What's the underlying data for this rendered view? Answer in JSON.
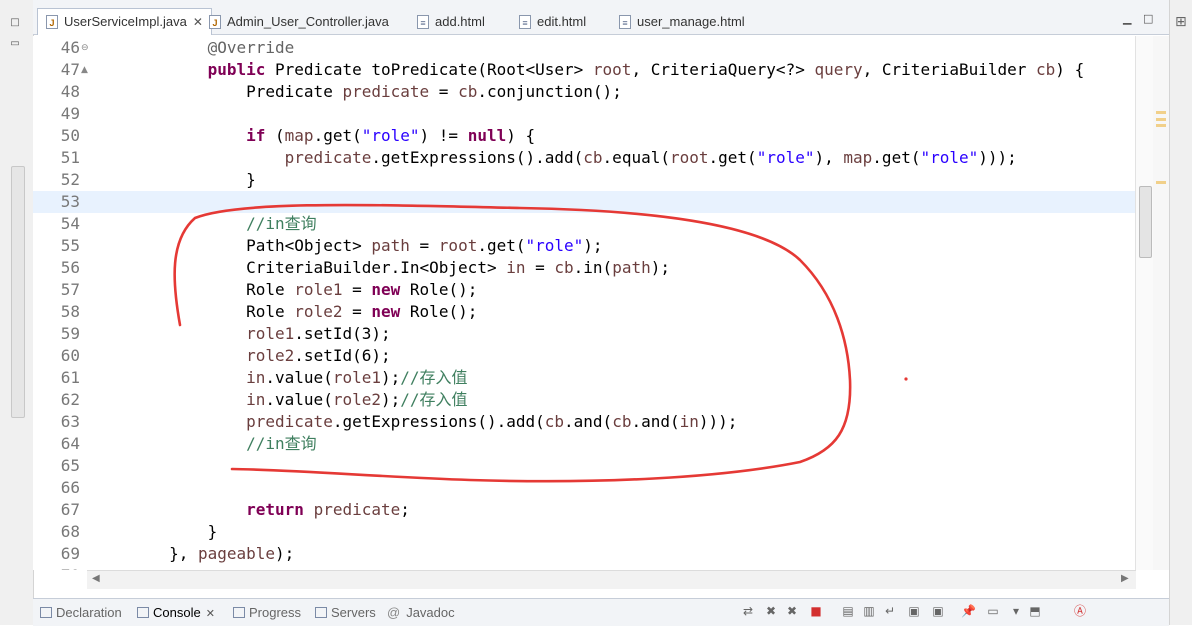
{
  "editor": {
    "tabs": [
      {
        "label": "UserServiceImpl.java",
        "icon": "java-file-icon",
        "active": true,
        "closable": true
      },
      {
        "label": "Admin_User_Controller.java",
        "icon": "java-file-icon"
      },
      {
        "label": "add.html",
        "icon": "html-file-icon"
      },
      {
        "label": "edit.html",
        "icon": "html-file-icon"
      },
      {
        "label": "user_manage.html",
        "icon": "html-file-icon"
      }
    ],
    "lines": [
      {
        "n": "46",
        "fold": "⊖",
        "segs": [
          [
            "            ",
            ""
          ],
          [
            "@Override",
            "an"
          ]
        ]
      },
      {
        "n": "47",
        "fold": "▲",
        "segs": [
          [
            "            ",
            ""
          ],
          [
            "public",
            "kw"
          ],
          [
            " Predicate toPredicate(Root<User> ",
            ""
          ],
          [
            "root",
            "vr"
          ],
          [
            ", CriteriaQuery<?> ",
            ""
          ],
          [
            "query",
            "vr"
          ],
          [
            ", CriteriaBuilder ",
            ""
          ],
          [
            "cb",
            "vr"
          ],
          [
            ") {",
            ""
          ]
        ]
      },
      {
        "n": "48",
        "segs": [
          [
            "                Predicate ",
            ""
          ],
          [
            "predicate",
            "vr"
          ],
          [
            " = ",
            ""
          ],
          [
            "cb",
            "vr"
          ],
          [
            ".conjunction();",
            ""
          ]
        ]
      },
      {
        "n": "49",
        "segs": [
          [
            "",
            ""
          ]
        ]
      },
      {
        "n": "50",
        "segs": [
          [
            "                ",
            ""
          ],
          [
            "if",
            "kw"
          ],
          [
            " (",
            ""
          ],
          [
            "map",
            "vr"
          ],
          [
            ".get(",
            ""
          ],
          [
            "\"role\"",
            "st"
          ],
          [
            ") != ",
            ""
          ],
          [
            "null",
            "kw"
          ],
          [
            ") {",
            ""
          ]
        ]
      },
      {
        "n": "51",
        "segs": [
          [
            "                    ",
            ""
          ],
          [
            "predicate",
            "vr"
          ],
          [
            ".getExpressions().add(",
            ""
          ],
          [
            "cb",
            "vr"
          ],
          [
            ".equal(",
            ""
          ],
          [
            "root",
            "vr"
          ],
          [
            ".get(",
            ""
          ],
          [
            "\"role\"",
            "st"
          ],
          [
            "), ",
            ""
          ],
          [
            "map",
            "vr"
          ],
          [
            ".get(",
            ""
          ],
          [
            "\"role\"",
            "st"
          ],
          [
            ")));",
            ""
          ]
        ]
      },
      {
        "n": "52",
        "segs": [
          [
            "                }",
            ""
          ]
        ]
      },
      {
        "n": "53",
        "hl": true,
        "segs": [
          [
            "",
            ""
          ]
        ]
      },
      {
        "n": "54",
        "segs": [
          [
            "                ",
            ""
          ],
          [
            "//in查询",
            "cm"
          ]
        ]
      },
      {
        "n": "55",
        "segs": [
          [
            "                Path<Object> ",
            ""
          ],
          [
            "path",
            "vr"
          ],
          [
            " = ",
            ""
          ],
          [
            "root",
            "vr"
          ],
          [
            ".get(",
            ""
          ],
          [
            "\"role\"",
            "st"
          ],
          [
            ");",
            ""
          ]
        ]
      },
      {
        "n": "56",
        "segs": [
          [
            "                CriteriaBuilder.In<Object> ",
            ""
          ],
          [
            "in",
            "vr"
          ],
          [
            " = ",
            ""
          ],
          [
            "cb",
            "vr"
          ],
          [
            ".in(",
            ""
          ],
          [
            "path",
            "vr"
          ],
          [
            ");",
            ""
          ]
        ]
      },
      {
        "n": "57",
        "segs": [
          [
            "                Role ",
            ""
          ],
          [
            "role1",
            "vr"
          ],
          [
            " = ",
            ""
          ],
          [
            "new",
            "kw"
          ],
          [
            " Role();",
            ""
          ]
        ]
      },
      {
        "n": "58",
        "segs": [
          [
            "                Role ",
            ""
          ],
          [
            "role2",
            "vr"
          ],
          [
            " = ",
            ""
          ],
          [
            "new",
            "kw"
          ],
          [
            " Role();",
            ""
          ]
        ]
      },
      {
        "n": "59",
        "segs": [
          [
            "                ",
            ""
          ],
          [
            "role1",
            "vr"
          ],
          [
            ".setId(3);",
            ""
          ]
        ]
      },
      {
        "n": "60",
        "segs": [
          [
            "                ",
            ""
          ],
          [
            "role2",
            "vr"
          ],
          [
            ".setId(6);",
            ""
          ]
        ]
      },
      {
        "n": "61",
        "segs": [
          [
            "                ",
            ""
          ],
          [
            "in",
            "vr"
          ],
          [
            ".value(",
            ""
          ],
          [
            "role1",
            "vr"
          ],
          [
            ");",
            ""
          ],
          [
            "//存入值",
            "cm"
          ]
        ]
      },
      {
        "n": "62",
        "segs": [
          [
            "                ",
            ""
          ],
          [
            "in",
            "vr"
          ],
          [
            ".value(",
            ""
          ],
          [
            "role2",
            "vr"
          ],
          [
            ");",
            ""
          ],
          [
            "//存入值",
            "cm"
          ]
        ]
      },
      {
        "n": "63",
        "segs": [
          [
            "                ",
            ""
          ],
          [
            "predicate",
            "vr"
          ],
          [
            ".getExpressions().add(",
            ""
          ],
          [
            "cb",
            "vr"
          ],
          [
            ".and(",
            ""
          ],
          [
            "cb",
            "vr"
          ],
          [
            ".and(",
            ""
          ],
          [
            "in",
            "vr"
          ],
          [
            ")));",
            ""
          ]
        ]
      },
      {
        "n": "64",
        "segs": [
          [
            "                ",
            ""
          ],
          [
            "//in查询",
            "cm"
          ]
        ]
      },
      {
        "n": "65",
        "segs": [
          [
            "",
            ""
          ]
        ]
      },
      {
        "n": "66",
        "segs": [
          [
            "",
            ""
          ]
        ]
      },
      {
        "n": "67",
        "segs": [
          [
            "                ",
            ""
          ],
          [
            "return",
            "kw"
          ],
          [
            " ",
            ""
          ],
          [
            "predicate",
            "vr"
          ],
          [
            ";",
            ""
          ]
        ]
      },
      {
        "n": "68",
        "segs": [
          [
            "            }",
            ""
          ]
        ]
      },
      {
        "n": "69",
        "segs": [
          [
            "        }, ",
            ""
          ],
          [
            "pageable",
            "vr"
          ],
          [
            ");",
            ""
          ]
        ]
      },
      {
        "n": "70",
        "segs": [
          [
            "",
            ""
          ]
        ]
      }
    ]
  },
  "bottom_tabs": [
    {
      "label": "Declaration",
      "icon": "declaration-icon"
    },
    {
      "label": "Console",
      "icon": "console-icon",
      "active": true,
      "closable": true
    },
    {
      "label": "Progress",
      "icon": "progress-icon"
    },
    {
      "label": "Servers",
      "icon": "servers-icon"
    },
    {
      "label": "Javadoc",
      "icon": "javadoc-icon"
    }
  ],
  "console_toolbar": [
    "sync-icon",
    "terminate-icon",
    "remove-all-icon",
    "stop-icon",
    "clear-console-icon",
    "scroll-lock-icon",
    "word-wrap-icon",
    "show-stdout-icon",
    "show-stderr-icon",
    "pin-console-icon",
    "display-console-icon",
    "open-console-icon",
    "server-icon",
    "ant-icon"
  ],
  "colors": {
    "keyword": "#7f0055",
    "string": "#2a00ff",
    "comment": "#3f7f5f",
    "annotation": "#646464",
    "variable": "#6a3e3e",
    "current_line": "#e8f2fe",
    "annotation_ink": "#e53935"
  }
}
